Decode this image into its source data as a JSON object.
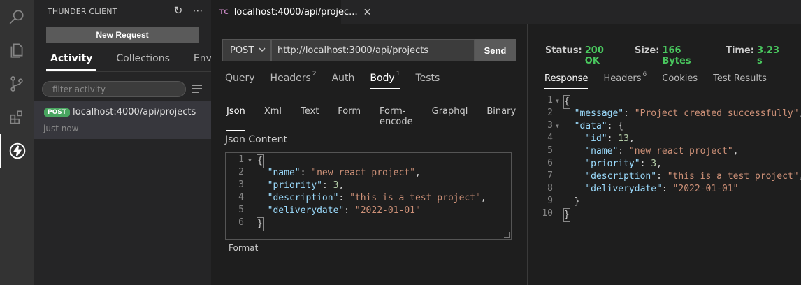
{
  "sidebar": {
    "title": "THUNDER CLIENT",
    "new_request_label": "New Request",
    "tabs": [
      {
        "label": "Activity"
      },
      {
        "label": "Collections"
      },
      {
        "label": "Env"
      }
    ],
    "filter_placeholder": "filter activity",
    "activity_items": [
      {
        "method": "POST",
        "url": "localhost:4000/api/projects",
        "time": "just now"
      }
    ]
  },
  "editor_tab": {
    "logo": "TC",
    "title": "localhost:4000/api/projec..."
  },
  "request": {
    "method": "POST",
    "url": "http://localhost:3000/api/projects",
    "send_label": "Send",
    "tabs": [
      {
        "label": "Query",
        "count": ""
      },
      {
        "label": "Headers",
        "count": "2"
      },
      {
        "label": "Auth",
        "count": ""
      },
      {
        "label": "Body",
        "count": "1"
      },
      {
        "label": "Tests",
        "count": ""
      }
    ],
    "body_tabs": [
      "Json",
      "Xml",
      "Text",
      "Form",
      "Form-encode",
      "Graphql",
      "Binary"
    ],
    "json_content_label": "Json Content",
    "format_label": "Format",
    "body_lines": [
      "1",
      "2",
      "3",
      "4",
      "5",
      "6"
    ],
    "body": {
      "name": "new react project",
      "priority": "3",
      "description": "this is a test project",
      "deliverydate": "2022-01-01"
    }
  },
  "response": {
    "status_label": "Status:",
    "status_value": "200 OK",
    "size_label": "Size:",
    "size_value": "166 Bytes",
    "time_label": "Time:",
    "time_value": "3.23 s",
    "tabs": [
      {
        "label": "Response",
        "count": ""
      },
      {
        "label": "Headers",
        "count": "6"
      },
      {
        "label": "Cookies",
        "count": ""
      },
      {
        "label": "Test Results",
        "count": ""
      }
    ],
    "line_numbers": [
      "1",
      "2",
      "3",
      "4",
      "5",
      "6",
      "7",
      "8",
      "9",
      "10"
    ],
    "message": "Project created successfully",
    "data": {
      "id": "13",
      "name": "new react project",
      "priority": "3",
      "description": "this is a test project",
      "deliverydate": "2022-01-01"
    }
  },
  "icons": {
    "activity_bar": [
      "search-icon",
      "files-icon",
      "source-control-icon",
      "extensions-icon",
      "thunder-client-icon"
    ]
  },
  "colors": {
    "accent_green": "#49a660",
    "status_green": "#49c75e",
    "json_key": "#9cdcfe",
    "json_string": "#ce9178",
    "json_number": "#b5cea8"
  }
}
